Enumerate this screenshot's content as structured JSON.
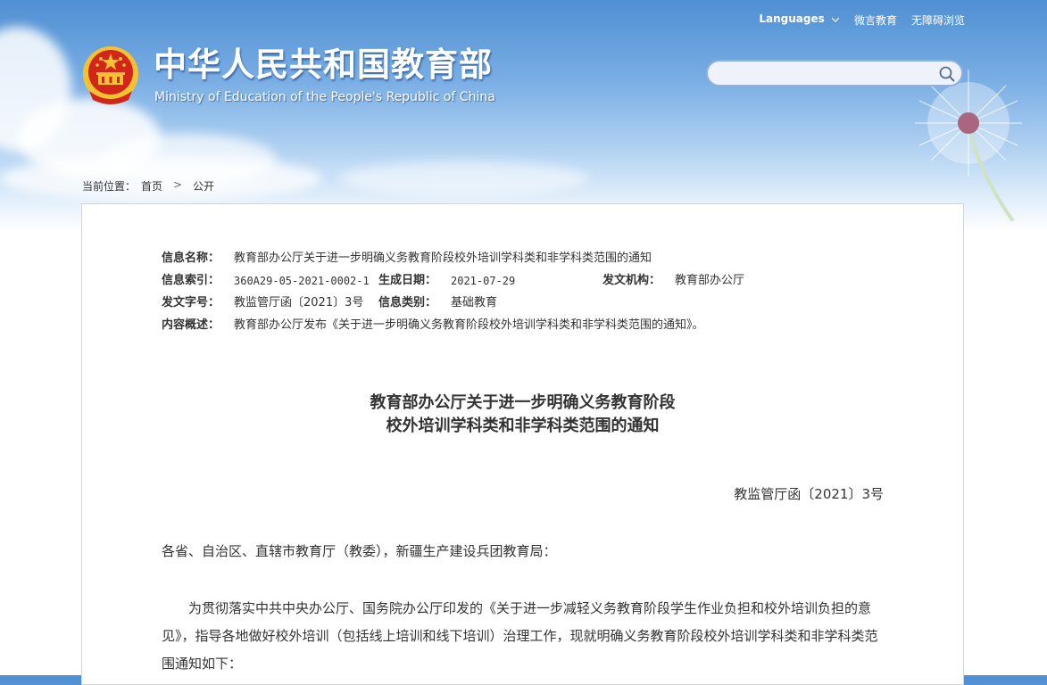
{
  "header": {
    "site_title": "中华人民共和国教育部",
    "site_subtitle": "Ministry of Education of the People's Republic of China",
    "links": {
      "languages": "Languages",
      "weibo": "微言教育",
      "accessibility": "无障碍浏览"
    }
  },
  "search": {
    "value": "",
    "placeholder": ""
  },
  "breadcrumb": {
    "prefix": "当前位置：",
    "home": "首页",
    "separator": ">",
    "current": "公开"
  },
  "meta": {
    "name_label": "信息名称：",
    "name_value": "教育部办公厅关于进一步明确义务教育阶段校外培训学科类和非学科类范围的通知",
    "index_label": "信息索引：",
    "index_value": "360A29-05-2021-0002-1",
    "date_label": "生成日期：",
    "date_value": "2021-07-29",
    "issuer_label": "发文机构：",
    "issuer_value": "教育部办公厅",
    "docno_label": "发文字号：",
    "docno_value": "教监管厅函〔2021〕3号",
    "category_label": "信息类别：",
    "category_value": "基础教育",
    "summary_label": "内容概述：",
    "summary_value": "教育部办公厅发布《关于进一步明确义务教育阶段校外培训学科类和非学科类范围的通知》。"
  },
  "document": {
    "title_line1": "教育部办公厅关于进一步明确义务教育阶段",
    "title_line2": "校外培训学科类和非学科类范围的通知",
    "number": "教监管厅函〔2021〕3号",
    "addressee": "各省、自治区、直辖市教育厅（教委），新疆生产建设兵团教育局：",
    "body": "为贯彻落实中共中央办公厅、国务院办公厅印发的《关于进一步减轻义务教育阶段学生作业负担和校外培训负担的意见》，指导各地做好校外培训（包括线上培训和线下培训）治理工作，现就明确义务教育阶段校外培训学科类和非学科类范围通知如下："
  },
  "icons": [
    "national-emblem-icon",
    "chevron-down-icon",
    "search-icon",
    "dandelion-icon"
  ],
  "colors": {
    "sky_top": "#4f8fd3",
    "emblem_red": "#d2261c",
    "emblem_gold": "#f3c233",
    "search_border": "#8fb1df"
  }
}
